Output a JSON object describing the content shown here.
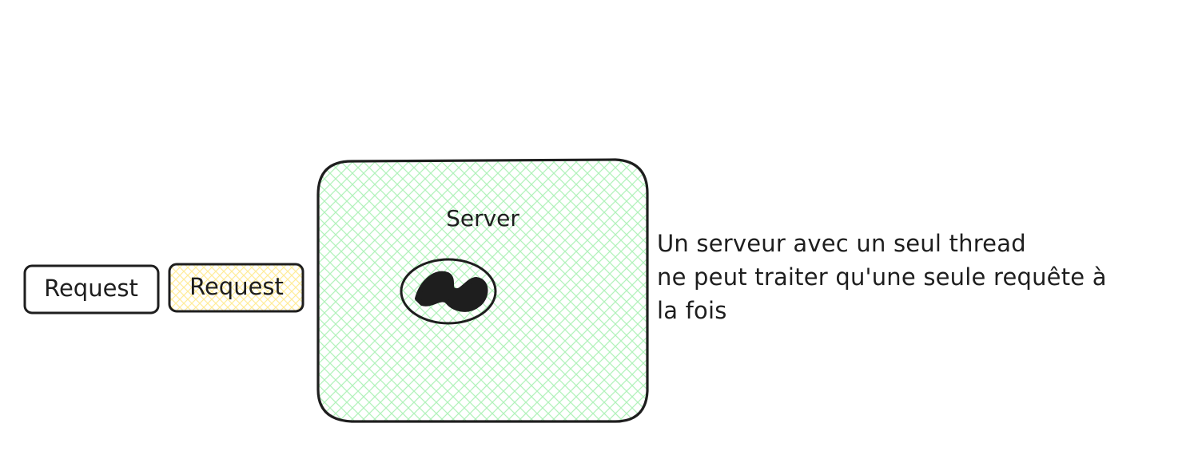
{
  "server": {
    "label": "Server",
    "fill_color": "#b2f2bb",
    "stroke_color": "#1e1e1e"
  },
  "requests": [
    {
      "label": "Request",
      "fill_color": "none"
    },
    {
      "label": "Request",
      "fill_color": "#ffec99"
    }
  ],
  "thread_icon": {
    "fill_color": "#1e1e1e"
  },
  "note": {
    "lines": [
      "Un serveur avec un seul thread",
      "ne peut traiter qu'une seule requête à",
      "la fois"
    ]
  }
}
